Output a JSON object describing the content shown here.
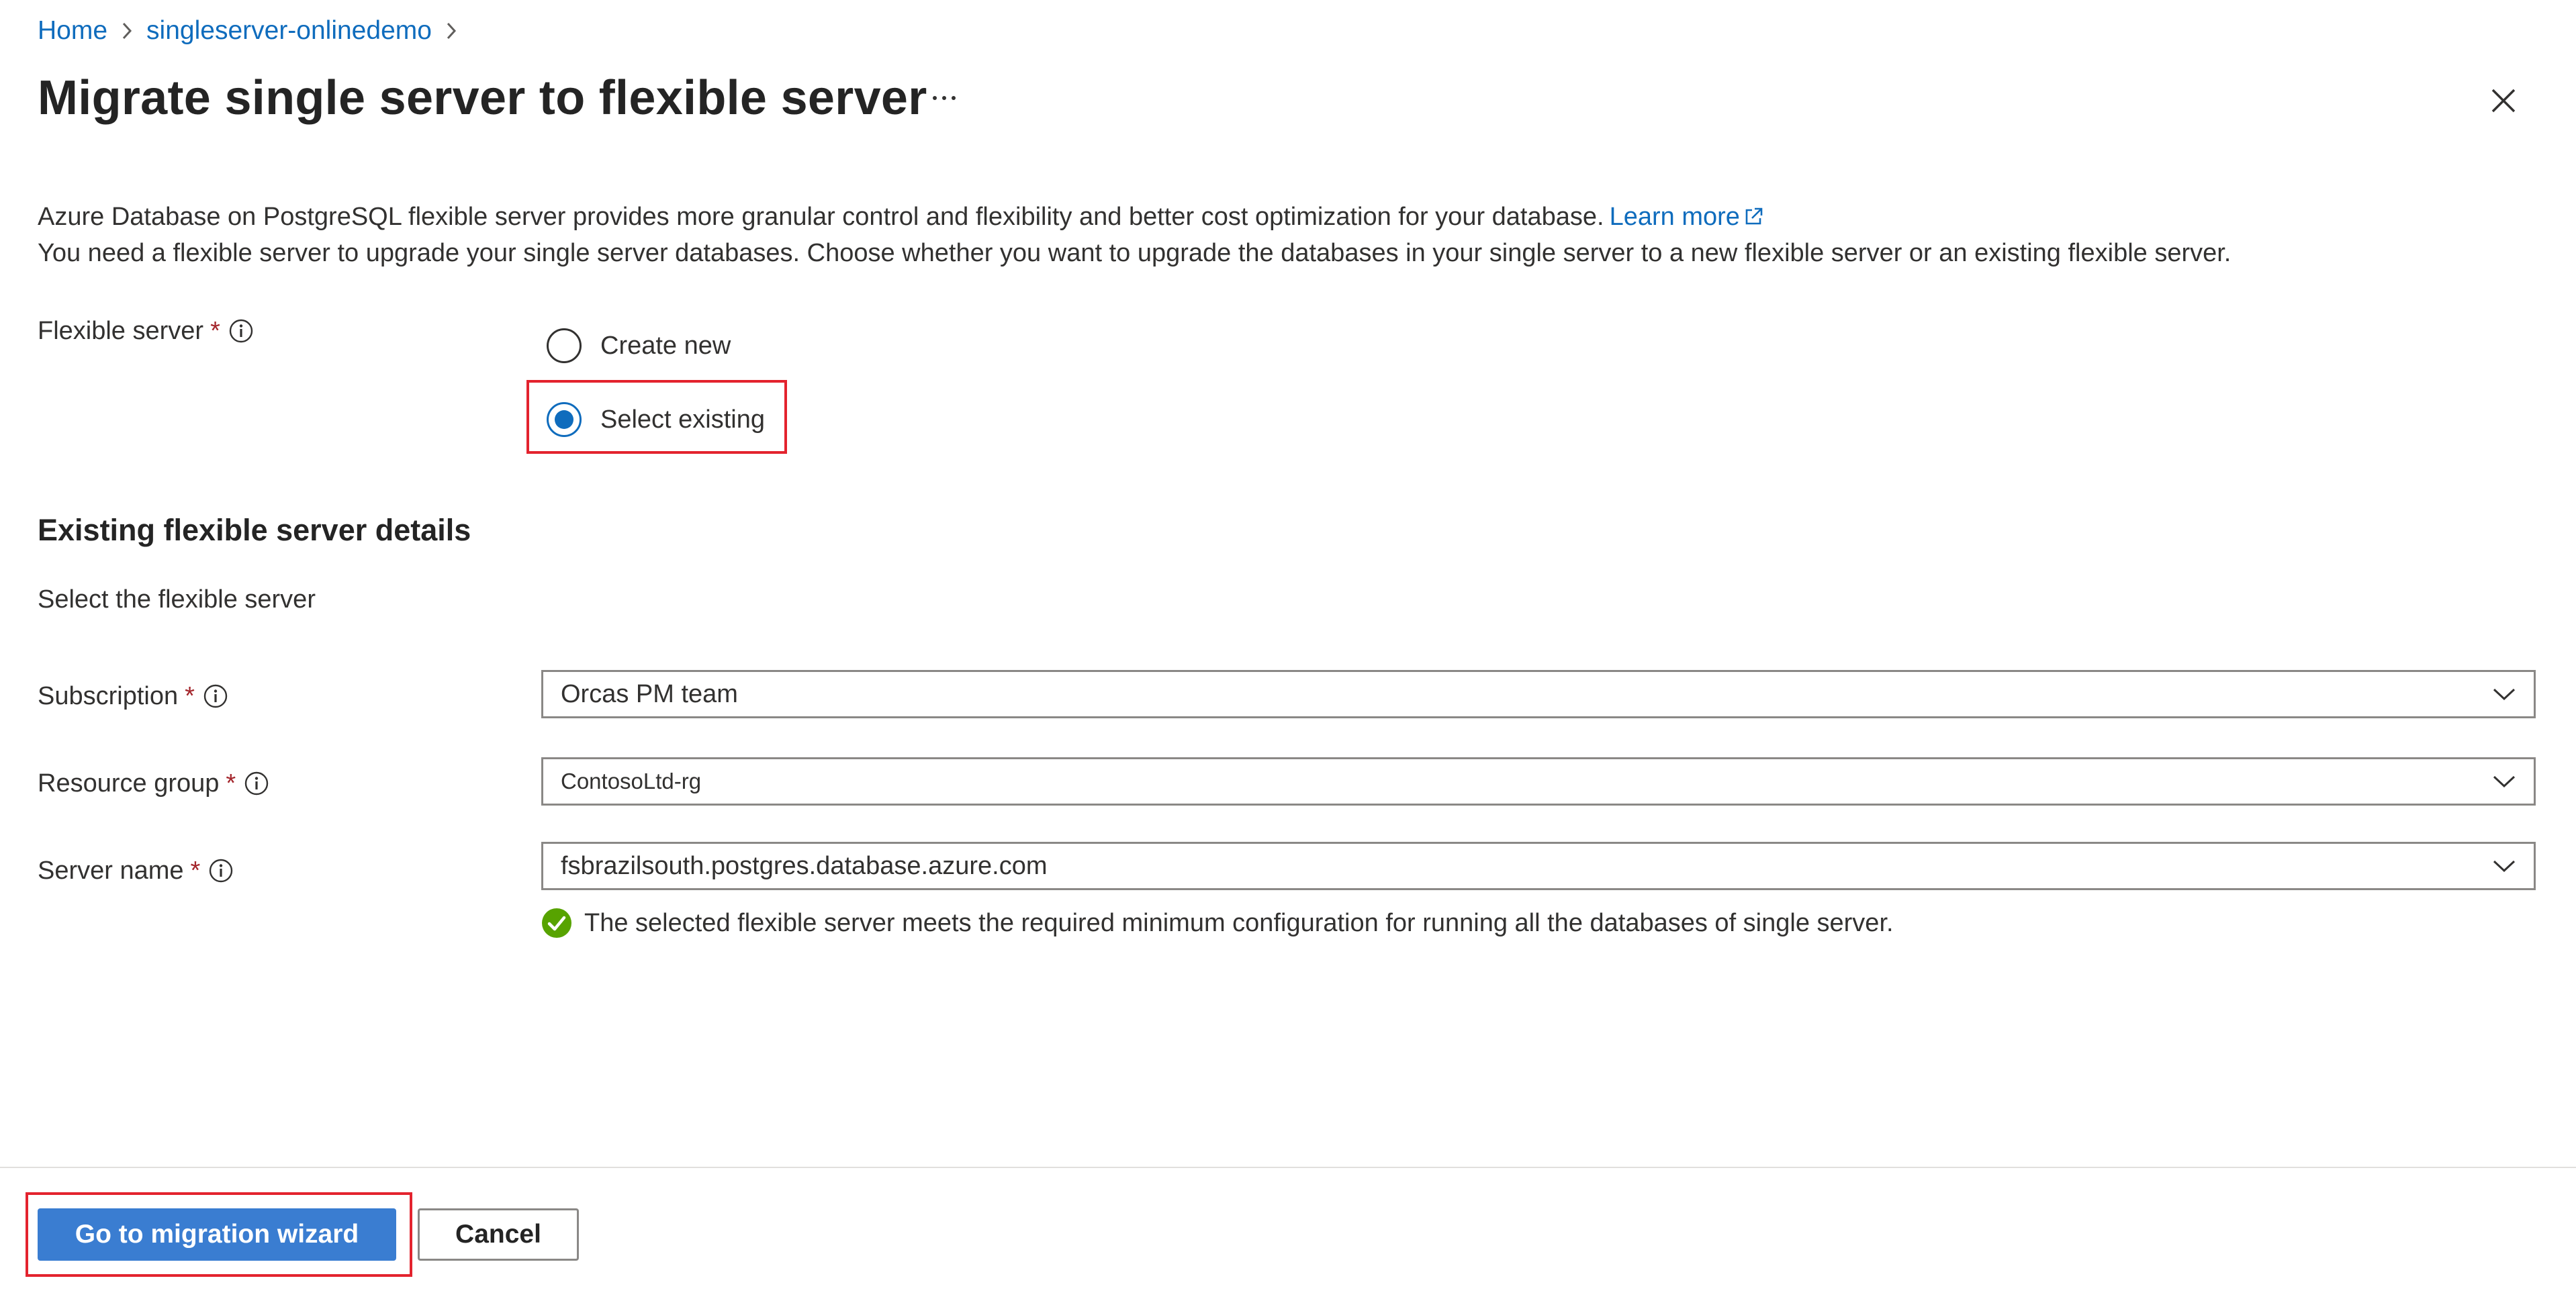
{
  "breadcrumb": {
    "items": [
      {
        "label": "Home"
      },
      {
        "label": "singleserver-onlinedemo"
      }
    ]
  },
  "header": {
    "title": "Migrate single server to flexible server",
    "more_label": "···"
  },
  "intro": {
    "line1": "Azure Database on PostgreSQL flexible server provides more granular control and flexibility and better cost optimization for your database.",
    "learn_more": "Learn more",
    "line2": "You need a flexible server to upgrade your single server databases. Choose whether you want to upgrade the databases in your single server to a new flexible server or an existing flexible server."
  },
  "flexible_server": {
    "label": "Flexible server",
    "required_mark": "*",
    "options": [
      {
        "label": "Create new",
        "checked": false
      },
      {
        "label": "Select existing",
        "checked": true
      }
    ]
  },
  "existing_details": {
    "title": "Existing flexible server details",
    "subtitle": "Select the flexible server",
    "subscription": {
      "label": "Subscription",
      "required_mark": "*",
      "value": "Orcas PM team"
    },
    "resource_group": {
      "label": "Resource group",
      "required_mark": "*",
      "value": "ContosoLtd-rg"
    },
    "server_name": {
      "label": "Server name",
      "required_mark": "*",
      "value": "fsbrazilsouth.postgres.database.azure.com"
    },
    "validation_message": "The selected flexible server meets the required minimum configuration for running all the databases of single server."
  },
  "footer": {
    "primary_label": "Go to migration wizard",
    "cancel_label": "Cancel"
  },
  "colors": {
    "link": "#0f6cbd",
    "primary_button": "#3a7dd1",
    "highlight": "#e3232e",
    "success": "#57a300",
    "required": "#a4262c"
  }
}
